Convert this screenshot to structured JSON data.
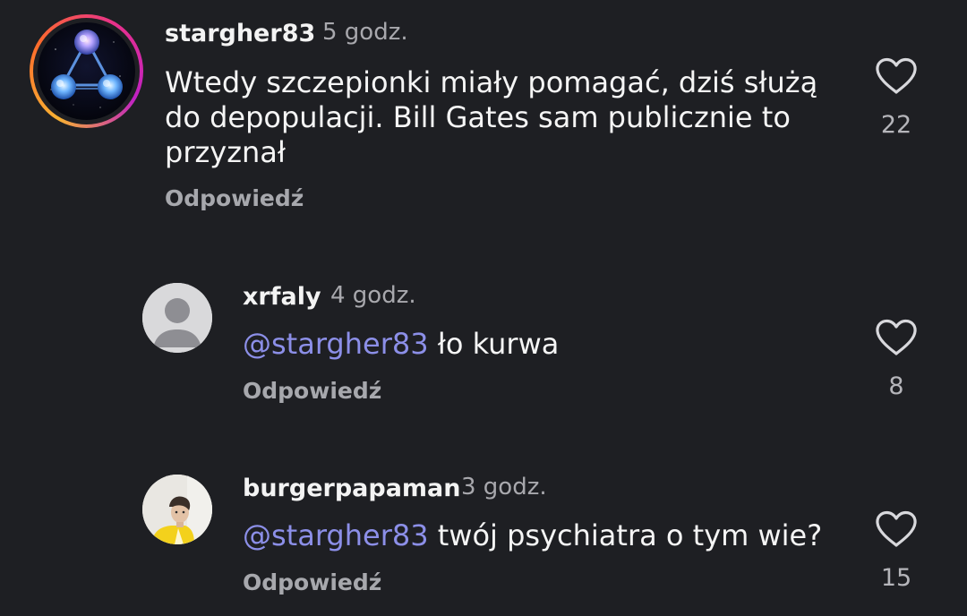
{
  "comments": [
    {
      "username": "stargher83",
      "time": "5 godz.",
      "text": "Wtedy szczepionki miały pomagać, dziś służą do depopulacji. Bill Gates sam publicznie to przyznał",
      "reply_label": "Odpowiedź",
      "likes": "22",
      "avatar_icon": "triangle-network-avatar"
    },
    {
      "username": "xrfaly",
      "time": "4 godz.",
      "mention": "@stargher83",
      "text": " ło kurwa",
      "reply_label": "Odpowiedź",
      "likes": "8",
      "avatar_icon": "default-avatar"
    },
    {
      "username": "burgerpapaman",
      "time": "3 godz.",
      "mention": "@stargher83",
      "text": " twój psychiatra o tym wie?",
      "reply_label": "Odpowiedź",
      "likes": "15",
      "avatar_icon": "profile-photo-avatar"
    }
  ],
  "colors": {
    "background": "#1e1f23",
    "mention": "#8c8fe8",
    "muted": "#a8a8ad"
  }
}
